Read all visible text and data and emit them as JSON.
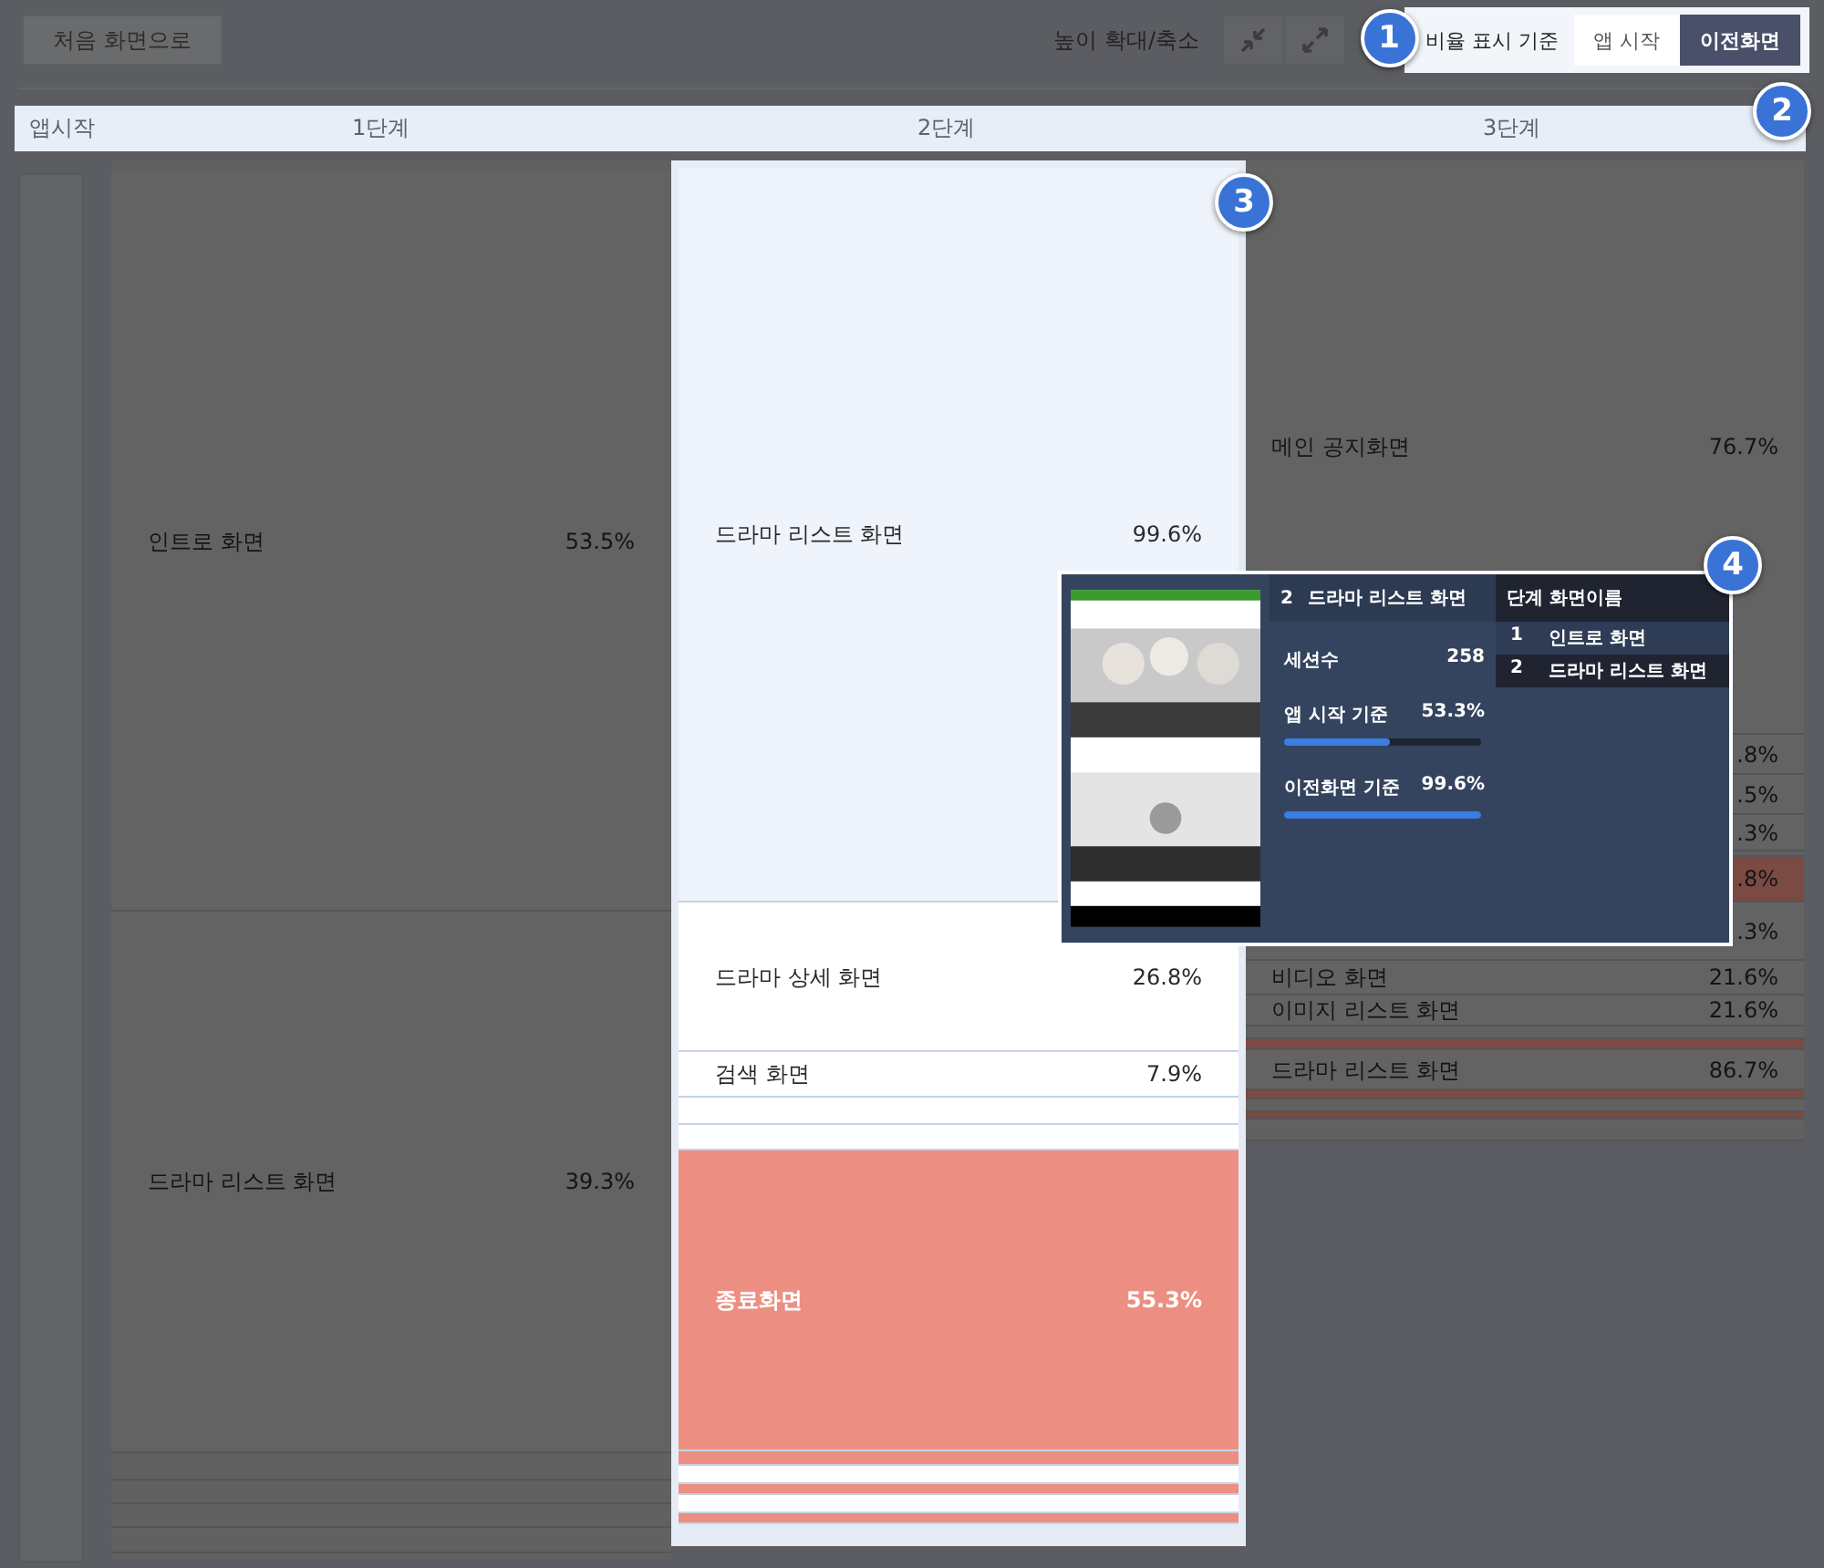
{
  "toolbar": {
    "home_button": "처음 화면으로",
    "zoom_label": "높이 확대/축소",
    "ratio_label": "비율 표시 기준",
    "ratio_options": [
      {
        "label": "앱 시작",
        "selected": false
      },
      {
        "label": "이전화면",
        "selected": true
      }
    ]
  },
  "header": [
    "앱시작",
    "1단계",
    "2단계",
    "3단계"
  ],
  "columns": [
    {
      "highlighted": false,
      "cells": [
        {
          "kind": "screen",
          "selected": false,
          "name": "인트로 화면",
          "value": "53.5%"
        },
        {
          "kind": "screen",
          "selected": false,
          "name": "드라마 리스트 화면",
          "value": "39.3%"
        },
        {
          "kind": "blank",
          "selected": false
        },
        {
          "kind": "blank",
          "selected": false
        },
        {
          "kind": "blank",
          "selected": false
        },
        {
          "kind": "blank",
          "selected": false
        }
      ]
    },
    {
      "highlighted": true,
      "cells": [
        {
          "kind": "screen",
          "selected": true,
          "name": "드라마 리스트 화면",
          "value": "99.6%"
        },
        {
          "kind": "screen",
          "selected": false,
          "name": "드라마 상세 화면",
          "value": "26.8%"
        },
        {
          "kind": "screen",
          "selected": false,
          "name": "검색 화면",
          "value": "7.9%"
        },
        {
          "kind": "blank",
          "selected": false
        },
        {
          "kind": "blank",
          "selected": false
        },
        {
          "kind": "exit",
          "selected": false,
          "name": "종료화면",
          "value": "55.3%"
        },
        {
          "kind": "exit",
          "selected": false
        },
        {
          "kind": "blank",
          "selected": false
        },
        {
          "kind": "exit",
          "selected": false
        },
        {
          "kind": "blank",
          "selected": false
        },
        {
          "kind": "exit",
          "selected": false
        }
      ]
    },
    {
      "highlighted": false,
      "cells": [
        {
          "kind": "screen",
          "selected": false,
          "name": "메인 공지화면",
          "value": "76.7%"
        },
        {
          "kind": "screen",
          "selected": false,
          "value": ".8%"
        },
        {
          "kind": "screen",
          "selected": false,
          "value": ".5%"
        },
        {
          "kind": "screen",
          "selected": false,
          "value": ".3%"
        },
        {
          "kind": "blank",
          "selected": false
        },
        {
          "kind": "exit",
          "selected": false,
          "value": ".8%"
        },
        {
          "kind": "screen",
          "selected": false,
          "value": ".3%"
        },
        {
          "kind": "screen",
          "selected": false,
          "name": "비디오 화면",
          "value": "21.6%"
        },
        {
          "kind": "screen",
          "selected": false,
          "name": "이미지 리스트 화면",
          "value": "21.6%"
        },
        {
          "kind": "blank",
          "selected": false
        },
        {
          "kind": "exit",
          "selected": false
        },
        {
          "kind": "screen",
          "selected": false,
          "name": "드라마 리스트 화면",
          "value": "86.7%"
        },
        {
          "kind": "exit",
          "selected": false
        },
        {
          "kind": "blank",
          "selected": false
        },
        {
          "kind": "exit",
          "selected": false
        },
        {
          "kind": "blank",
          "selected": false
        }
      ]
    }
  ],
  "tooltip": {
    "step": "2",
    "title": "드라마 리스트 화면",
    "sessions_label": "세션수",
    "sessions": "258",
    "metrics": [
      {
        "label": "앱 시작 기준",
        "value": "53.3%",
        "level": 0.533
      },
      {
        "label": "이전화면 기준",
        "value": "99.6%",
        "level": 0.996
      }
    ],
    "path_header": "단계 화면이름",
    "path": [
      {
        "step": "1",
        "name": "인트로 화면",
        "selected": false
      },
      {
        "step": "2",
        "name": "드라마 리스트 화면",
        "selected": true
      }
    ]
  },
  "markers": [
    "1",
    "2",
    "3",
    "4"
  ]
}
